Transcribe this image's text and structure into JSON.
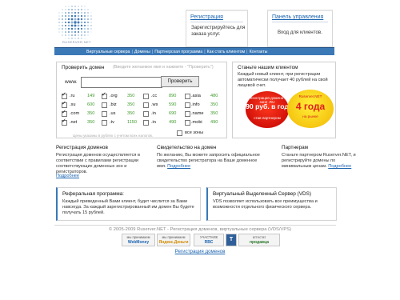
{
  "logo": {
    "text": "RUSERVER.NET"
  },
  "top_boxes": {
    "register": {
      "title": "Регистрация",
      "desc_lines": [
        "Зарегистрируйтесь для",
        "заказа услуг."
      ]
    },
    "control_panel": {
      "title": "Панель управления",
      "desc": "Вход для клиентов."
    }
  },
  "nav": {
    "items": [
      "Виртуальные сервера",
      "Домены",
      "Партнерская программа",
      "Как стать клиентом",
      "Контакты"
    ],
    "separator": "|"
  },
  "domain_check": {
    "title": "Проверить домен",
    "hint": "(Введите желаемое имя и нажмите - \"Проверить\")",
    "www_label": "www.",
    "input_value": "",
    "button_label": "Проверить",
    "zones": [
      [
        {
          "zone": ".ru",
          "price": "149",
          "checked": true
        },
        {
          "zone": ".org",
          "price": "350",
          "checked": true
        },
        {
          "zone": ".cc",
          "price": "890",
          "checked": false
        },
        {
          "zone": ".asia",
          "price": "480",
          "checked": false
        }
      ],
      [
        {
          "zone": ".su",
          "price": "600",
          "checked": true
        },
        {
          "zone": ".biz",
          "price": "350",
          "checked": false
        },
        {
          "zone": ".ws",
          "price": "590",
          "checked": false
        },
        {
          "zone": ".info",
          "price": "350",
          "checked": false
        }
      ],
      [
        {
          "zone": ".com",
          "price": "350",
          "checked": true
        },
        {
          "zone": ".us",
          "price": "350",
          "checked": false
        },
        {
          "zone": ".in",
          "price": "690",
          "checked": false
        },
        {
          "zone": ".name",
          "price": "350",
          "checked": false
        }
      ],
      [
        {
          "zone": ".net",
          "price": "350",
          "checked": true
        },
        {
          "zone": ".tv",
          "price": "1150",
          "checked": false
        },
        {
          "zone": ".in",
          "price": "490",
          "checked": false
        },
        {
          "zone": ".mobi",
          "price": "490",
          "checked": false
        }
      ]
    ],
    "all_zones_label": "все зоны",
    "footnote": "Цены указаны в рублях с учетом всех налогов."
  },
  "become_client": {
    "title": "Станьте нашим клиентом",
    "desc": "Каждый новый клиент, при регистрации автоматически получает 40 рублей на свой лицевой счет."
  },
  "badges": {
    "red": {
      "top": "Регистрация домена в зоне .RU",
      "big": "90 руб. в год",
      "bottom": "став партнером"
    },
    "yellow": {
      "top": "Ruserver.NET",
      "big": "4 года",
      "bottom": "на рынке"
    }
  },
  "columns": [
    {
      "heading": "Регистрация доменов",
      "text": "Регистрация доменов осуществляется в соответствии с правилами регистрации соответствующих доменных зон и регистраторов.",
      "more": "Подробнее"
    },
    {
      "heading": "Свидетельство на домен",
      "text": "По желанию, Вы можете запросить официальное свидетельство регистратора на Ваше доменное имя.",
      "more": "Подробнее"
    },
    {
      "heading": "Партнерам",
      "text": "Станьте партнером Ruserver.NET, и регистрируйте домены по минимальным ценам.",
      "more": "Подробнее"
    }
  ],
  "bottom_boxes": [
    {
      "heading": "Реферальная программа:",
      "text": "Каждый приведенный Вами клиент, будет числится за Вами навсегда. За каждый зарегистрированный им домен Вы будете получать 15 рублей."
    },
    {
      "heading": "Виртуальный Выделенный Сервер (VDS)",
      "text": "VDS позволяет использовать все преимущества и возможности отдельного физического сервера."
    }
  ],
  "footer": {
    "copyright": "© 2005-2009 Ruserver.NET - Регистрация доменов, виртуальные сервера (VDS/VPS)",
    "payments": [
      {
        "top": "мы принимаем",
        "logo": "WebMoney"
      },
      {
        "top": "мы принимаем",
        "logo": "Яндекс.Деньги"
      },
      {
        "top": "УЧАСТНИК",
        "logo": "RBC"
      },
      {
        "top": "",
        "logo": "T"
      },
      {
        "top": "аттестат",
        "logo": "продавца"
      }
    ],
    "link": "Регистрация доменов"
  }
}
